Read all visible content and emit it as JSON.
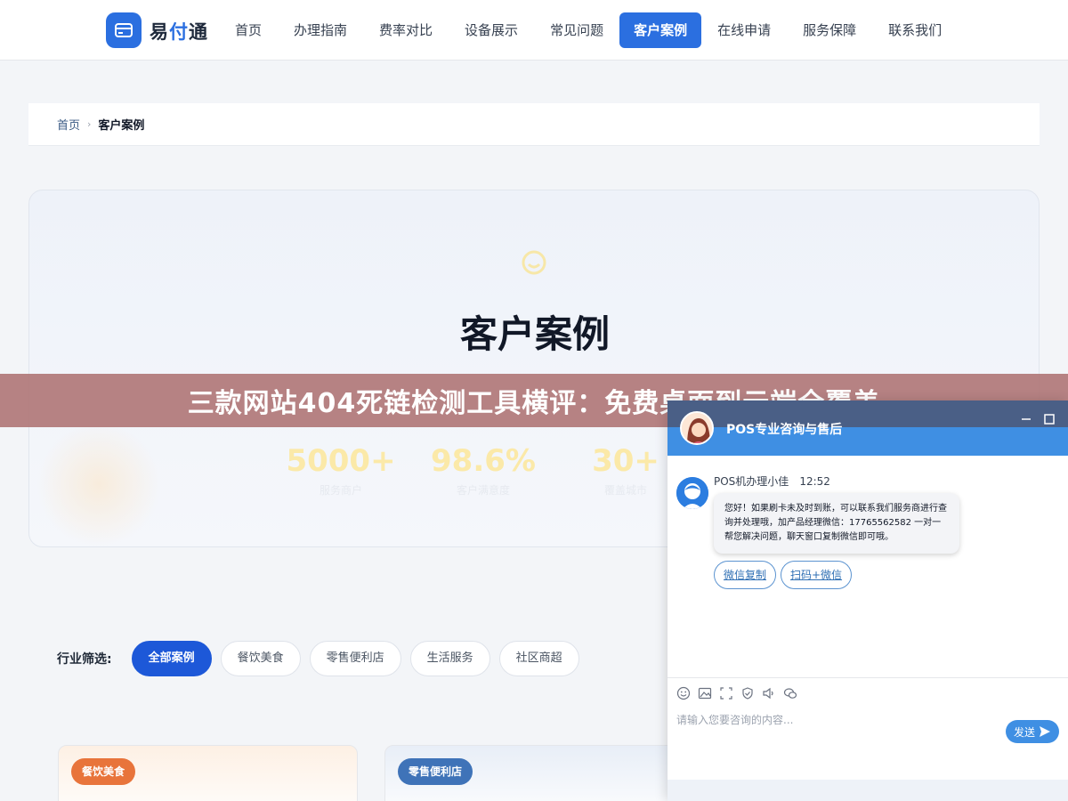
{
  "brand": {
    "prefix": "易",
    "accent": "付",
    "suffix": "通",
    "color": "#2b6fe0"
  },
  "nav": {
    "items": [
      "首页",
      "办理指南",
      "费率对比",
      "设备展示",
      "常见问题",
      "客户案例",
      "在线申请",
      "服务保障",
      "联系我们"
    ],
    "active": "客户案例"
  },
  "breadcrumb": {
    "home": "首页",
    "separator": "›",
    "current": "客户案例"
  },
  "hero": {
    "title": "客户案例",
    "stats": [
      {
        "value": "5000+",
        "label": "服务商户"
      },
      {
        "value": "98.6%",
        "label": "客户满意度"
      },
      {
        "value": "30+",
        "label": "覆盖城市"
      }
    ]
  },
  "banner": {
    "text": "三款网站404死链检测工具横评：免费桌面到云端全覆盖"
  },
  "filter": {
    "label": "行业筛选:",
    "options": [
      "全部案例",
      "餐饮美食",
      "零售便利店",
      "生活服务",
      "社区商超"
    ],
    "active": "全部案例"
  },
  "cards": [
    {
      "tag": "餐饮美食"
    },
    {
      "tag": "零售便利店"
    }
  ],
  "chat": {
    "title": "POS专业咨询与售后",
    "agent_name": "POS机办理小佳",
    "time": "12:52",
    "message": "您好！如果刷卡未及时到账，可以联系我们服务商进行查询并处理哦，加产品经理微信：17765562582 一对一帮您解决问题，聊天窗口复制微信即可哦。",
    "buttons": [
      "微信复制",
      "扫码+微信"
    ],
    "toolbar_icons": [
      "emoji-icon",
      "image-icon",
      "screenshot-icon",
      "rate-icon",
      "voice-icon",
      "wechat-icon"
    ],
    "input_placeholder": "请输入您要咨询的内容...",
    "send_label": "发送"
  }
}
